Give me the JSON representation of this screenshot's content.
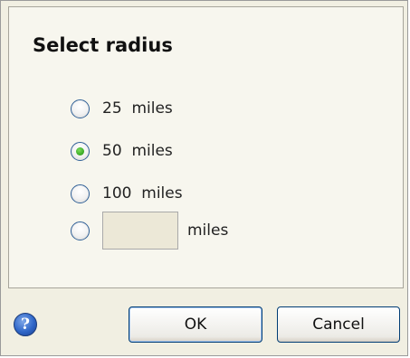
{
  "dialog": {
    "title": "Select radius",
    "options": [
      {
        "label": "25  miles",
        "checked": false
      },
      {
        "label": "50  miles",
        "checked": true
      },
      {
        "label": "100  miles",
        "checked": false
      }
    ],
    "custom": {
      "value": "",
      "unit": "miles",
      "checked": false
    },
    "help_icon": "help-icon",
    "buttons": {
      "ok_label": "OK",
      "cancel_label": "Cancel"
    }
  }
}
